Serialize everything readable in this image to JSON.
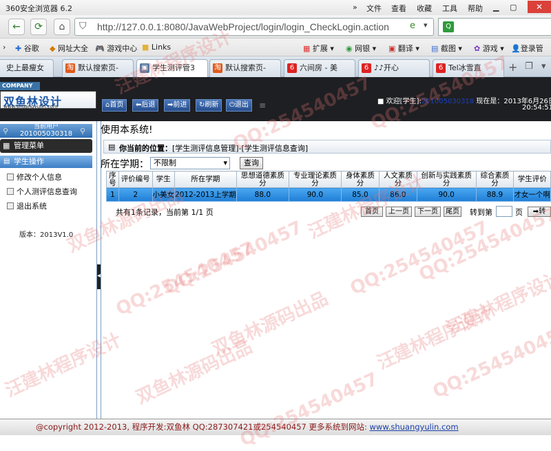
{
  "browser": {
    "title": "360安全浏览器 6.2",
    "menu": [
      "文件",
      "查看",
      "收藏",
      "工具",
      "帮助"
    ],
    "address": "http://127.0.0.1:8080/JavaWebProject/login/login_CheckLogin.action",
    "bookmarks": [
      "谷歌",
      "网址大全",
      "游戏中心",
      "Links"
    ],
    "right_tools": [
      "扩展",
      "网银",
      "翻译",
      "截图",
      "游戏",
      "登录管"
    ],
    "tabs": [
      "史上最瘦女",
      "默认搜索页-",
      "学生测评管3",
      "默认搜索页-",
      "六间房 - 美",
      "♪♪开心",
      "Tel冰雪直"
    ]
  },
  "header": {
    "company": "COMPANY",
    "logo_title": "双鱼林设计",
    "logo_url": "www.shuangyulin.com",
    "toolbar": [
      "首页",
      "后退",
      "前进",
      "刷新",
      "退出"
    ],
    "welcome_prefix": "欢迎[学生]:",
    "user_id": "201005030318",
    "now_label": "现在是：2013年6月26日",
    "time": "20:54:51"
  },
  "sidebar": {
    "user_label": "当前用户",
    "user_id": "201005030318",
    "menu_title": "管理菜单",
    "section": "学生操作",
    "items": [
      "修改个人信息",
      "个人测评信息查询",
      "退出系统"
    ],
    "version": "版本：2013V1.0"
  },
  "main": {
    "marquee": "使用本系统!",
    "position_label": "你当前的位置：",
    "position_path": "[学生测评信息管理]-[学生测评信息查询]",
    "filter_label": "所在学期：",
    "filter_value": "不限制",
    "query_button": "查询",
    "columns": [
      "序号",
      "评价编号",
      "学生",
      "所在学期",
      "思想道德素质分",
      "专业理论素质分",
      "身体素质分",
      "人文素质分",
      "创新与实践素质分",
      "综合素质分",
      "学生评价"
    ],
    "rows": [
      [
        "1",
        "2",
        "小美女",
        "2012-2013上学期",
        "88.0",
        "90.0",
        "85.0",
        "86.0",
        "90.0",
        "88.9",
        "才女一个啊"
      ]
    ],
    "pager_info": "共有1条记录，当前第 1/1 页",
    "pager_buttons": [
      "首页",
      "上一页",
      "下一页",
      "尾页"
    ],
    "goto_label": "转到第",
    "goto_unit": "页",
    "goto_button": "转"
  },
  "footer": {
    "text": "@copyright 2012-2013, 程序开发:双鱼林  QQ:287307421或254540457  更多系统到网站:",
    "link": "www.shuangyulin.com"
  },
  "watermarks": {
    "qq": "QQ:254540457",
    "design": "汪建林程序设计",
    "source": "双鱼林源码出品"
  }
}
